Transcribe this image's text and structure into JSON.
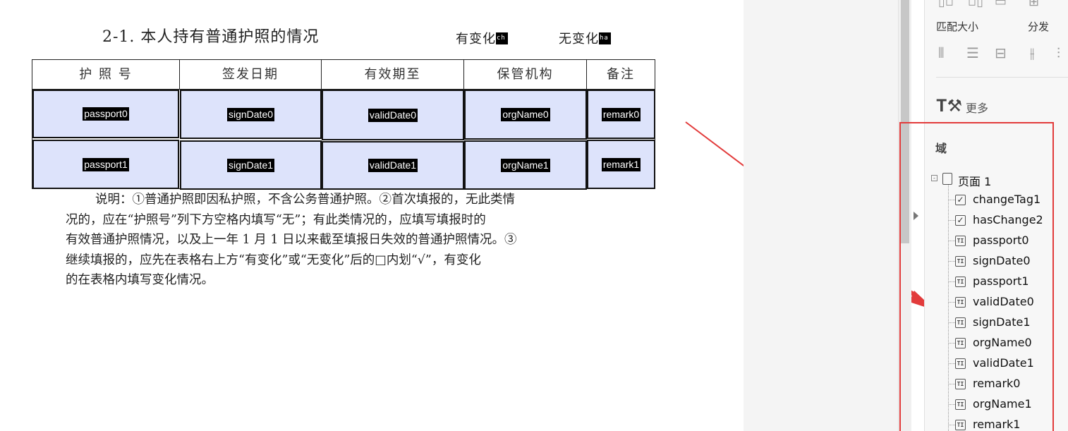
{
  "document": {
    "section_title": "2-1. 本人持有普通护照的情况",
    "changed_label": "有变化",
    "changed_field": "ch",
    "unchanged_label": "无变化",
    "unchanged_field": "ha",
    "table": {
      "headers": [
        "护 照 号",
        "签发日期",
        "有效期至",
        "保管机构",
        "备注"
      ],
      "rows": [
        [
          "passport0",
          "signDate0",
          "validDate0",
          "orgName0",
          "remark0"
        ],
        [
          "passport1",
          "signDate1",
          "validDate1",
          "orgName1",
          "remark1"
        ]
      ]
    },
    "note_lines": [
      "说明：①普通护照即因私护照，不含公务普通护照。②首次填报的，无此类情",
      "况的，应在“护照号”列下方空格内填写“无”；有此类情况的，应填写填报时的",
      "有效普通护照情况，以及上一年 1 月 1 日以来截至填报日失效的普通护照情况。③",
      "继续填报的，应先在表格右上方“有变化”或“无变化”后的□内划“√”，有变化",
      "的在表格内填写变化情况。"
    ]
  },
  "panel": {
    "match_size_label": "匹配大小",
    "distribute_label": "分发",
    "more_label": "更多",
    "fields_title": "域",
    "page_node": "页面 1",
    "fields": [
      {
        "name": "changeTag1",
        "type": "checkbox"
      },
      {
        "name": "hasChange2",
        "type": "checkbox"
      },
      {
        "name": "passport0",
        "type": "text"
      },
      {
        "name": "signDate0",
        "type": "text"
      },
      {
        "name": "passport1",
        "type": "text"
      },
      {
        "name": "validDate0",
        "type": "text"
      },
      {
        "name": "signDate1",
        "type": "text"
      },
      {
        "name": "orgName0",
        "type": "text"
      },
      {
        "name": "validDate1",
        "type": "text"
      },
      {
        "name": "remark0",
        "type": "text"
      },
      {
        "name": "orgName1",
        "type": "text"
      },
      {
        "name": "remark1",
        "type": "text"
      }
    ]
  },
  "colors": {
    "field_fill": "#dde3fb",
    "highlight_red": "#e23b3b"
  }
}
